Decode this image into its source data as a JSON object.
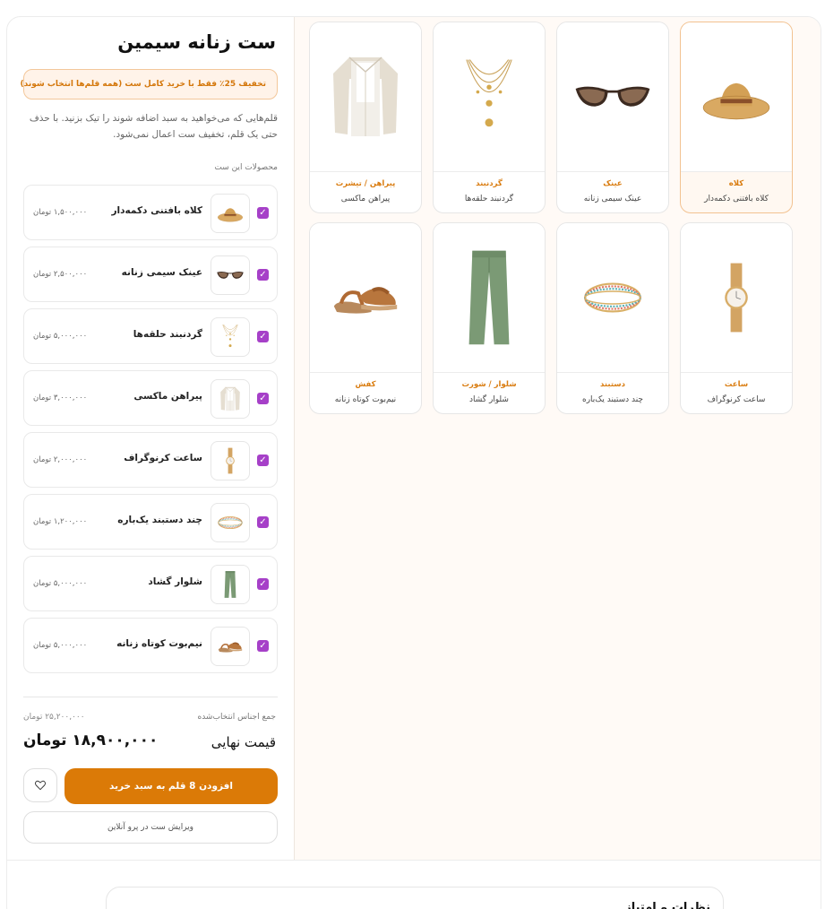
{
  "set": {
    "title": "ست زنانه سیمین",
    "promo": "تخفیف 25٪ فقط با خرید کامل ست (همه قلم‌ها انتخاب شوند)",
    "description": "قلم‌هایی که می‌خواهید به سبد اضافه شوند را تیک بزنید. با حذف حتی یک قلم، تخفیف ست اعمال نمی‌شود.",
    "products_label": "محصولات این ست"
  },
  "items": [
    {
      "name": "کلاه بافتنی دکمه‌دار",
      "price": "۱,۵۰۰,۰۰۰ تومان",
      "icon": "hat-icon",
      "checked": true
    },
    {
      "name": "عینک سیمی زنانه",
      "price": "۲,۵۰۰,۰۰۰ تومان",
      "icon": "sunglasses-icon",
      "checked": true
    },
    {
      "name": "گردنبند حلقه‌ها",
      "price": "۵,۰۰۰,۰۰۰ تومان",
      "icon": "necklace-icon",
      "checked": true
    },
    {
      "name": "پیراهن ماکسی",
      "price": "۳,۰۰۰,۰۰۰ تومان",
      "icon": "shirt-icon",
      "checked": true
    },
    {
      "name": "ساعت کرنوگراف",
      "price": "۲,۰۰۰,۰۰۰ تومان",
      "icon": "watch-icon",
      "checked": true
    },
    {
      "name": "چند دستبند یک‌باره",
      "price": "۱,۲۰۰,۰۰۰ تومان",
      "icon": "bracelet-icon",
      "checked": true
    },
    {
      "name": "شلوار گشاد",
      "price": "۵,۰۰۰,۰۰۰ تومان",
      "icon": "pants-icon",
      "checked": true
    },
    {
      "name": "نیم‌بوت کوتاه زنانه",
      "price": "۵,۰۰۰,۰۰۰ تومان",
      "icon": "sandal-icon",
      "checked": true
    }
  ],
  "summary": {
    "subtotal_label": "جمع اجناس انتخاب‌شده",
    "subtotal_value": "۲۵,۲۰۰,۰۰۰ تومان",
    "final_label": "قیمت نهایی",
    "final_value": "۱۸,۹۰۰,۰۰۰ تومان"
  },
  "actions": {
    "add_to_cart": "افزودن 8 قلم به سبد خرید",
    "edit_set": "ویرایش ست در پرو آنلاین"
  },
  "grid": [
    {
      "category": "کلاه",
      "name": "کلاه بافتنی دکمه‌دار",
      "icon": "hat-icon",
      "active": true
    },
    {
      "category": "عینک",
      "name": "عینک سیمی زنانه",
      "icon": "sunglasses-icon",
      "active": false
    },
    {
      "category": "گردنبند",
      "name": "گردنبند حلقه‌ها",
      "icon": "necklace-icon",
      "active": false
    },
    {
      "category": "پیراهن / تیشرت",
      "name": "پیراهن ماکسی",
      "icon": "shirt-icon",
      "active": false
    },
    {
      "category": "ساعت",
      "name": "ساعت کرنوگراف",
      "icon": "watch-icon",
      "active": false
    },
    {
      "category": "دستبند",
      "name": "چند دستبند یک‌باره",
      "icon": "bracelet-icon",
      "active": false
    },
    {
      "category": "شلوار / شورت",
      "name": "شلوار گشاد",
      "icon": "pants-icon",
      "active": false
    },
    {
      "category": "کفش",
      "name": "نیم‌بوت کوتاه زنانه",
      "icon": "sandal-icon",
      "active": false
    }
  ],
  "reviews": {
    "title": "نظرات و امتیاز"
  },
  "colors": {
    "accent": "#db7a07",
    "check": "#a640c8",
    "promo_bg": "#fff3e9"
  }
}
